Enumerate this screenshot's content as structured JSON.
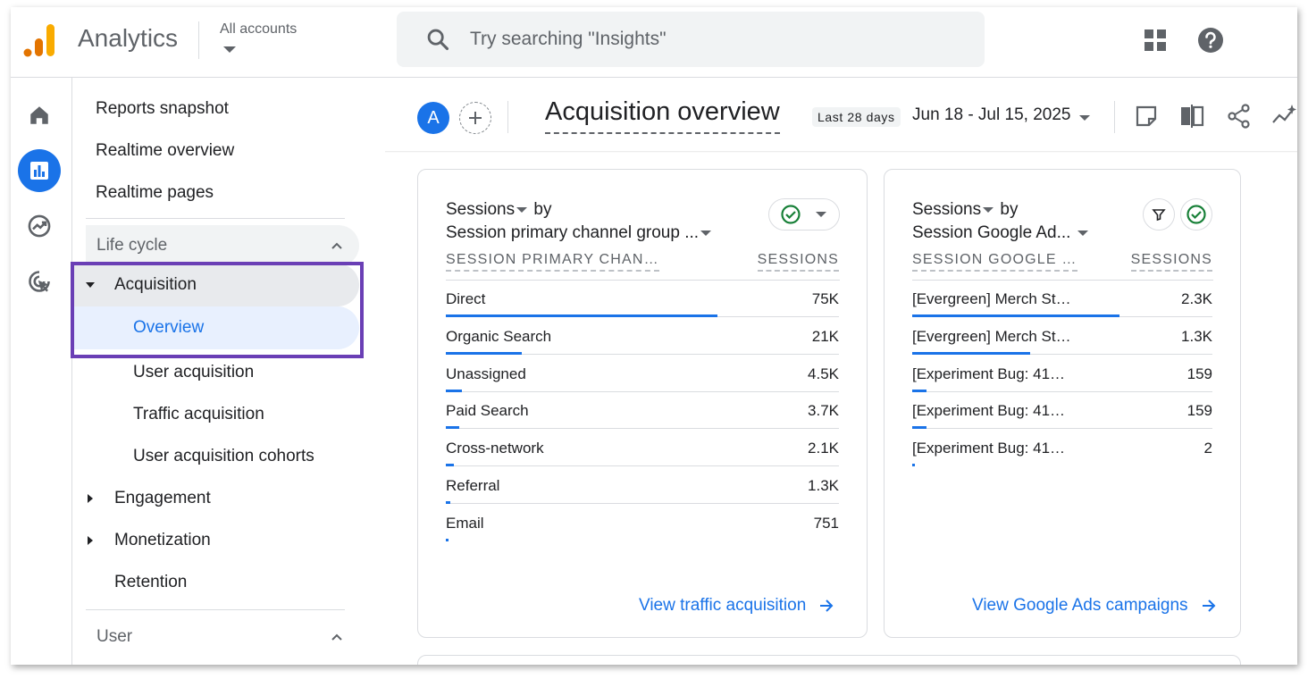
{
  "app": {
    "title": "Analytics",
    "accounts_label": "All accounts"
  },
  "search": {
    "placeholder": "Try searching \"Insights\""
  },
  "icons": {
    "logo": "analytics-logo",
    "search": "search-icon",
    "apps": "apps-grid-icon",
    "help": "help-icon",
    "rail": [
      "home-icon",
      "reports-icon",
      "explore-icon",
      "advertising-icon"
    ]
  },
  "sidebar": {
    "top_items": [
      "Reports snapshot",
      "Realtime overview",
      "Realtime pages"
    ],
    "lifecycle": {
      "label": "Life cycle",
      "acquisition": "Acquisition",
      "overview": "Overview",
      "sub": [
        "User acquisition",
        "Traffic acquisition",
        "User acquisition cohorts"
      ],
      "engagement": "Engagement",
      "monetization": "Monetization",
      "retention": "Retention"
    },
    "user_section": "User"
  },
  "header": {
    "avatar": "A",
    "title": "Acquisition overview",
    "date_chip": "Last 28 days",
    "date_range": "Jun 18 - Jul 15, 2025"
  },
  "cards": [
    {
      "metric": "Sessions",
      "by": "by",
      "dimension": "Session primary channel group ...",
      "col_dim": "SESSION PRIMARY CHAN…",
      "col_metric": "SESSIONS",
      "rows": [
        {
          "label": "Direct",
          "value": "75K",
          "share": 1.0
        },
        {
          "label": "Organic Search",
          "value": "21K",
          "share": 0.28
        },
        {
          "label": "Unassigned",
          "value": "4.5K",
          "share": 0.06
        },
        {
          "label": "Paid Search",
          "value": "3.7K",
          "share": 0.05
        },
        {
          "label": "Cross-network",
          "value": "2.1K",
          "share": 0.028
        },
        {
          "label": "Referral",
          "value": "1.3K",
          "share": 0.017
        },
        {
          "label": "Email",
          "value": "751",
          "share": 0.01
        }
      ],
      "link": "View traffic acquisition"
    },
    {
      "metric": "Sessions",
      "by": "by",
      "dimension": "Session Google Ad...",
      "col_dim": "SESSION GOOGLE …",
      "col_metric": "SESSIONS",
      "rows": [
        {
          "label": "[Evergreen] Merch St…",
          "value": "2.3K",
          "share": 1.0
        },
        {
          "label": "[Evergreen] Merch St…",
          "value": "1.3K",
          "share": 0.57
        },
        {
          "label": "[Experiment Bug: 41…",
          "value": "159",
          "share": 0.07
        },
        {
          "label": "[Experiment Bug: 41…",
          "value": "159",
          "share": 0.07
        },
        {
          "label": "[Experiment Bug: 41…",
          "value": "2",
          "share": 0.0
        }
      ],
      "link": "View Google Ads campaigns"
    }
  ],
  "colors": {
    "accent": "#1a73e8",
    "highlight_border": "#6a3fb5",
    "check": "#188038"
  }
}
